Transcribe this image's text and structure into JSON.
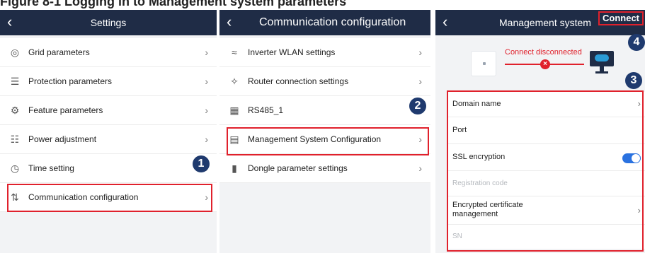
{
  "caption": "Figure 8-1 Logging in to Management system parameters",
  "panel1": {
    "title": "Settings",
    "items": [
      {
        "icon": "grid-icon",
        "label": "Grid parameters"
      },
      {
        "icon": "protection-icon",
        "label": "Protection parameters"
      },
      {
        "icon": "feature-icon",
        "label": "Feature parameters"
      },
      {
        "icon": "power-icon",
        "label": "Power adjustment"
      },
      {
        "icon": "clock-icon",
        "label": "Time setting"
      },
      {
        "icon": "communication-icon",
        "label": "Communication configuration"
      }
    ],
    "step": "1"
  },
  "panel2": {
    "title": "Communication configuration",
    "items": [
      {
        "icon": "wifi-icon",
        "label": "Inverter WLAN settings"
      },
      {
        "icon": "share-icon",
        "label": "Router connection settings"
      },
      {
        "icon": "rs485-icon",
        "label": "RS485_1"
      },
      {
        "icon": "monitor-icon",
        "label": "Management System Configuration"
      },
      {
        "icon": "dongle-icon",
        "label": "Dongle parameter settings"
      }
    ],
    "step": "2"
  },
  "panel3": {
    "title": "Management system",
    "connect": "Connect",
    "status": "Connect disconnected",
    "fields": {
      "domain": "Domain name",
      "port": "Port",
      "ssl": "SSL encryption",
      "registration": "Registration code",
      "certificate": "Encrypted certificate management",
      "sn": "SN"
    },
    "ssl_enabled": true,
    "step3": "3",
    "step4": "4"
  },
  "colors": {
    "header": "#1f2c46",
    "highlight": "#e0212c",
    "badge": "#1f3a6e",
    "toggle": "#2a72e0"
  }
}
